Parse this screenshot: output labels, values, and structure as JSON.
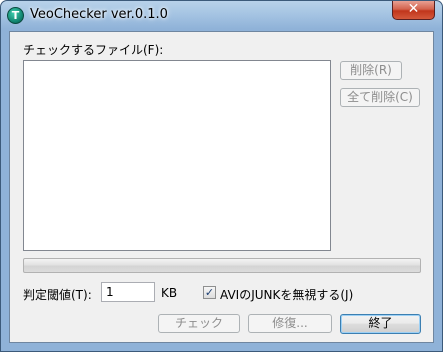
{
  "window": {
    "title": "VeoChecker ver.0.1.0",
    "app_icon_letter": "T",
    "close_glyph": "✕"
  },
  "file_list": {
    "label": "チェックするファイル(F):",
    "items": []
  },
  "buttons": {
    "delete": "削除(R)",
    "delete_all": "全て削除(C)",
    "check": "チェック",
    "repair": "修復...",
    "exit": "終了"
  },
  "progress": {
    "percent": 0
  },
  "threshold": {
    "label": "判定閾値(T):",
    "value": "1",
    "unit": "KB"
  },
  "ignore_avi_junk": {
    "label": "AVIのJUNKを無視する(J)",
    "checked": true,
    "check_glyph": "✓"
  },
  "colors": {
    "progress_fill": "#06b025",
    "titlebar": "#a4c3e2",
    "close_button": "#c1361c"
  }
}
